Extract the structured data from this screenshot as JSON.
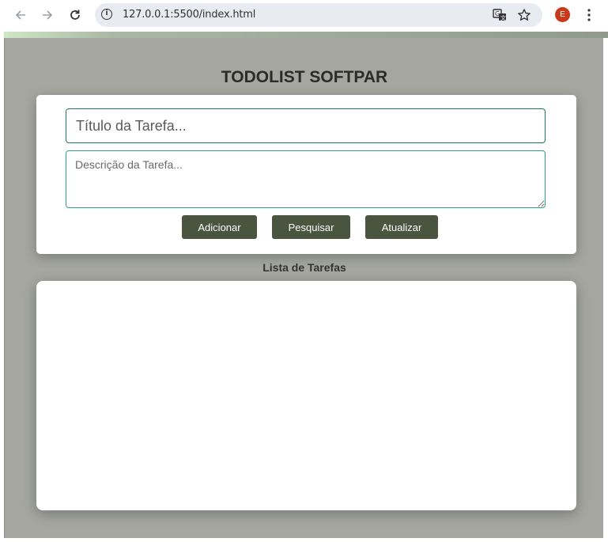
{
  "browser": {
    "url": "127.0.0.1:5500/index.html",
    "avatar_letter": "E",
    "icons": {
      "back": "arrow-left-icon",
      "forward": "arrow-right-icon",
      "reload": "reload-icon",
      "site_info": "info-icon",
      "translate": "translate-icon",
      "bookmark": "star-icon",
      "menu": "kebab-menu-icon"
    }
  },
  "page": {
    "title": "TODOLIST SOFTPAR",
    "form": {
      "title_placeholder": "Título da Tarefa...",
      "title_value": "",
      "description_placeholder": "Descrição da Tarefa...",
      "description_value": "",
      "buttons": {
        "add": "Adicionar",
        "search": "Pesquisar",
        "update": "Atualizar"
      }
    },
    "list_heading": "Lista de Tarefas",
    "tasks": []
  },
  "colors": {
    "page_background": "#a4a69f",
    "button": "#4a5540",
    "input_border": "#1f7a5a",
    "avatar": "#c9391c"
  }
}
